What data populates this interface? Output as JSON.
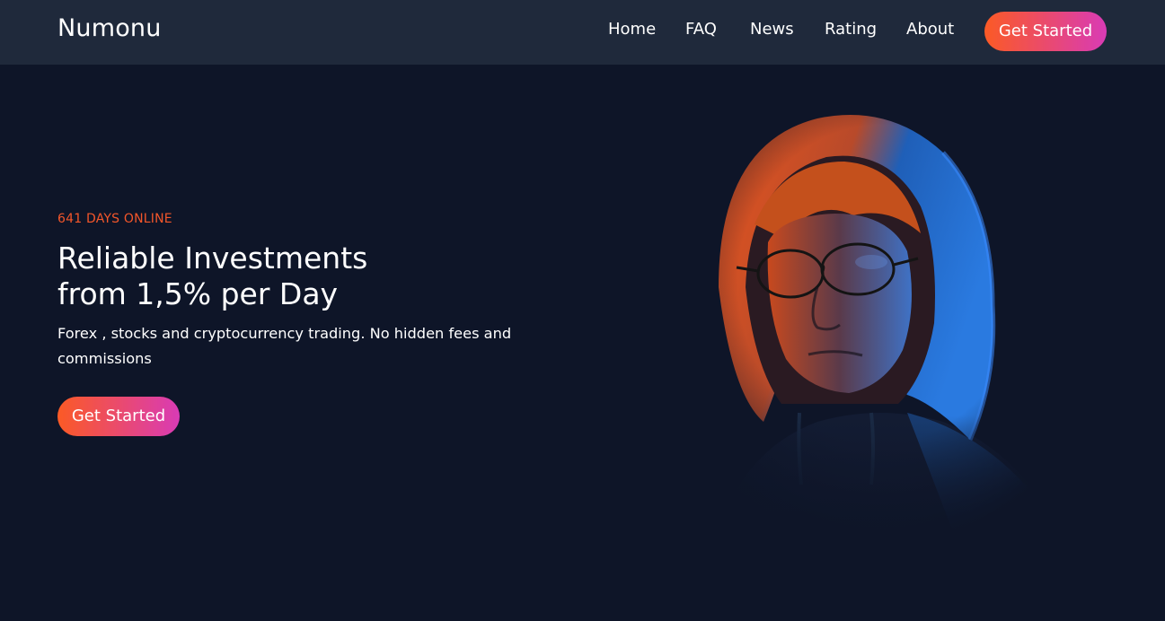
{
  "brand": {
    "name": "Numonu"
  },
  "nav": {
    "items": [
      {
        "label": "Home"
      },
      {
        "label": "FAQ"
      },
      {
        "label": "News"
      },
      {
        "label": "Rating"
      },
      {
        "label": "About"
      }
    ],
    "cta_label": "Get Started"
  },
  "hero": {
    "tagline": "641 DAYS ONLINE",
    "headline_line1": "Reliable Investments",
    "headline_line2": "from 1,5% per Day",
    "subtext": "Forex , stocks and cryptocurrency trading. No hidden fees and commissions",
    "cta_label": "Get Started"
  },
  "colors": {
    "background": "#0e1528",
    "navbar": "#1f293b",
    "accent_orange": "#f4562a",
    "gradient_start": "#fb5a25",
    "gradient_end": "#d93bb5",
    "portrait_blue": "#1f6fd6"
  },
  "images": {
    "hero_portrait": "hooded-person-with-glasses-portrait"
  }
}
